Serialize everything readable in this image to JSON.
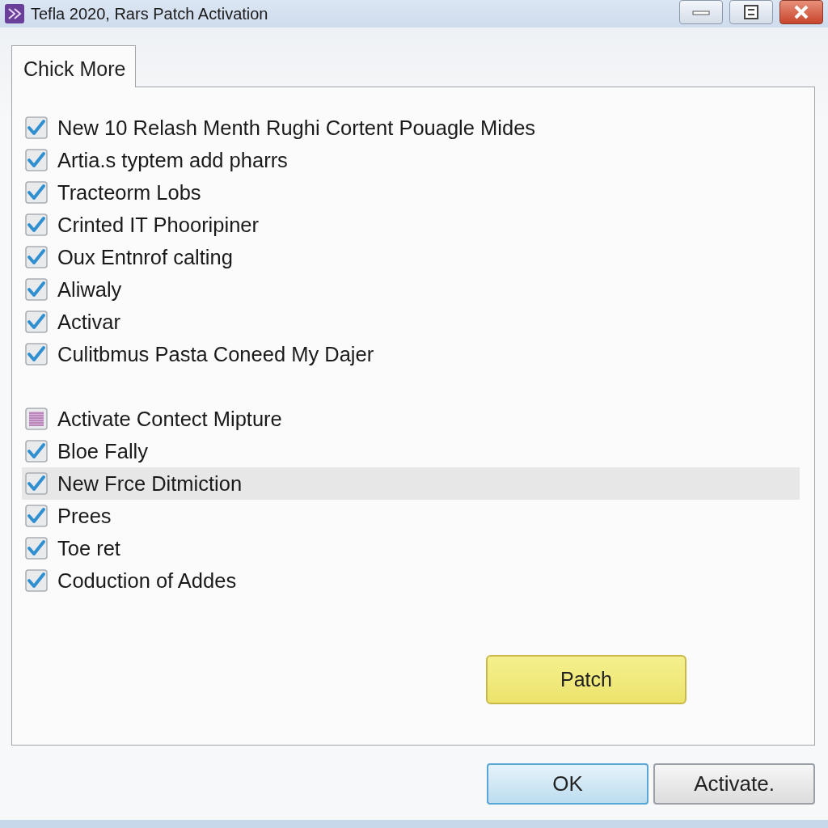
{
  "window": {
    "title": "Tefla 2020, Rars Patch Activation"
  },
  "tabs": [
    {
      "label": "Chick More",
      "selected": true
    }
  ],
  "option_groups": [
    [
      {
        "label": "New 10 Relash Menth Rughi Cortent Pouagle Mides",
        "checked": true,
        "indeterminate": false,
        "selected": false
      },
      {
        "label": "Artia.s typtem add pharrs",
        "checked": true,
        "indeterminate": false,
        "selected": false
      },
      {
        "label": "Tracteorm Lobs",
        "checked": true,
        "indeterminate": false,
        "selected": false
      },
      {
        "label": "Crinted IT Phooripiner",
        "checked": true,
        "indeterminate": false,
        "selected": false
      },
      {
        "label": "Oux Entnrof calting",
        "checked": true,
        "indeterminate": false,
        "selected": false
      },
      {
        "label": "Aliwaly",
        "checked": true,
        "indeterminate": false,
        "selected": false
      },
      {
        "label": "Activar",
        "checked": true,
        "indeterminate": false,
        "selected": false
      },
      {
        "label": "Culitbmus Pasta Coneed My Dajer",
        "checked": true,
        "indeterminate": false,
        "selected": false
      }
    ],
    [
      {
        "label": "Activate Contect Mipture",
        "checked": false,
        "indeterminate": true,
        "selected": false
      },
      {
        "label": "Bloe Fally",
        "checked": true,
        "indeterminate": false,
        "selected": false
      },
      {
        "label": "New Frce Ditmiction",
        "checked": true,
        "indeterminate": false,
        "selected": true
      },
      {
        "label": "Prees",
        "checked": true,
        "indeterminate": false,
        "selected": false
      },
      {
        "label": "Toe ret",
        "checked": true,
        "indeterminate": false,
        "selected": false
      },
      {
        "label": "Coduction of Addes",
        "checked": true,
        "indeterminate": false,
        "selected": false
      }
    ]
  ],
  "patch_button": "Patch",
  "buttons": [
    {
      "label": "OK",
      "kind": "default"
    },
    {
      "label": "Activate.",
      "kind": "normal"
    }
  ]
}
